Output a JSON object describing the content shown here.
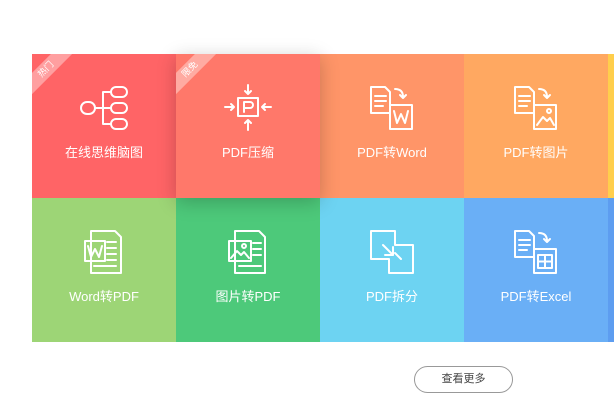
{
  "tools": [
    {
      "label": "在线思维脑图",
      "badge": "热门",
      "icon": "mind-map-icon",
      "color": "#FF6466"
    },
    {
      "label": "PDF压缩",
      "badge": "限免",
      "icon": "compress-icon",
      "color": "#FF786A"
    },
    {
      "label": "PDF转Word",
      "badge": "",
      "icon": "pdf-to-word-icon",
      "color": "#FF9568"
    },
    {
      "label": "PDF转图片",
      "badge": "",
      "icon": "pdf-to-image-icon",
      "color": "#FFA861"
    },
    {
      "label": "Word转PDF",
      "badge": "",
      "icon": "word-to-pdf-icon",
      "color": "#9DD576"
    },
    {
      "label": "图片转PDF",
      "badge": "",
      "icon": "image-to-pdf-icon",
      "color": "#4DC97A"
    },
    {
      "label": "PDF拆分",
      "badge": "",
      "icon": "pdf-split-icon",
      "color": "#6DD3F2"
    },
    {
      "label": "PDF转Excel",
      "badge": "",
      "icon": "pdf-to-excel-icon",
      "color": "#6AAFF6"
    }
  ],
  "more_button": {
    "label": "查看更多"
  }
}
